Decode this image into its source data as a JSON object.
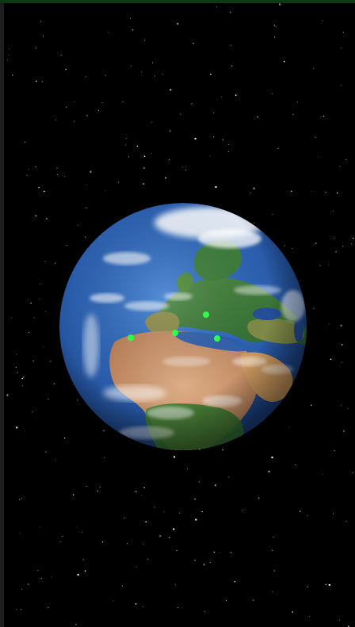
{
  "scene": {
    "top_bar_color": "#0e3a12",
    "background_color": "#000000",
    "ocean_color": "#2e64b4",
    "marker_color": "#2cff4a"
  },
  "globe": {
    "view": "earth-europe-africa"
  },
  "markers": [
    {
      "id": "marker-1",
      "color": "#2cff4a"
    },
    {
      "id": "marker-2",
      "color": "#2cff4a"
    },
    {
      "id": "marker-3",
      "color": "#2cff4a"
    },
    {
      "id": "marker-4",
      "color": "#2cff4a"
    }
  ]
}
